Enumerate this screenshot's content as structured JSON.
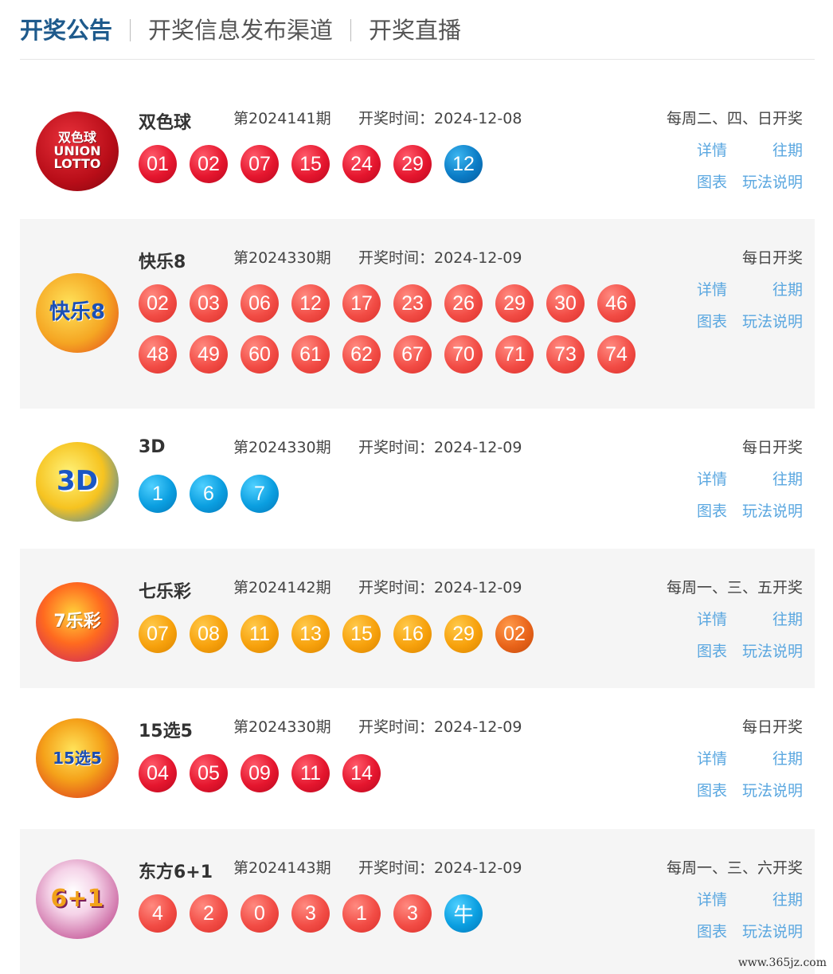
{
  "tabs": [
    "开奖公告",
    "开奖信息发布渠道",
    "开奖直播"
  ],
  "colors": {
    "accent": "#1e5a8c",
    "link": "#5aa7e0",
    "shaded_row": "#f5f5f5"
  },
  "link_labels": {
    "detail": "详情",
    "history": "往期",
    "chart": "图表",
    "rules": "玩法说明"
  },
  "lotteries": [
    {
      "name": "双色球",
      "logo_text": "双色球 UNION LOTTO",
      "issue": "第2024141期",
      "draw_time": "开奖时间：2024-12-08",
      "schedule": "每周二、四、日开奖",
      "balls": [
        {
          "n": "01",
          "c": "red"
        },
        {
          "n": "02",
          "c": "red"
        },
        {
          "n": "07",
          "c": "red"
        },
        {
          "n": "15",
          "c": "red"
        },
        {
          "n": "24",
          "c": "red"
        },
        {
          "n": "29",
          "c": "red"
        },
        {
          "n": "12",
          "c": "deepblue"
        }
      ]
    },
    {
      "name": "快乐8",
      "logo_text": "快乐8",
      "issue": "第2024330期",
      "draw_time": "开奖时间：2024-12-09",
      "schedule": "每日开奖",
      "balls": [
        {
          "n": "02",
          "c": "salmon"
        },
        {
          "n": "03",
          "c": "salmon"
        },
        {
          "n": "06",
          "c": "salmon"
        },
        {
          "n": "12",
          "c": "salmon"
        },
        {
          "n": "17",
          "c": "salmon"
        },
        {
          "n": "23",
          "c": "salmon"
        },
        {
          "n": "26",
          "c": "salmon"
        },
        {
          "n": "29",
          "c": "salmon"
        },
        {
          "n": "30",
          "c": "salmon"
        },
        {
          "n": "46",
          "c": "salmon"
        },
        {
          "n": "48",
          "c": "salmon"
        },
        {
          "n": "49",
          "c": "salmon"
        },
        {
          "n": "60",
          "c": "salmon"
        },
        {
          "n": "61",
          "c": "salmon"
        },
        {
          "n": "62",
          "c": "salmon"
        },
        {
          "n": "67",
          "c": "salmon"
        },
        {
          "n": "70",
          "c": "salmon"
        },
        {
          "n": "71",
          "c": "salmon"
        },
        {
          "n": "73",
          "c": "salmon"
        },
        {
          "n": "74",
          "c": "salmon"
        }
      ]
    },
    {
      "name": "3D",
      "logo_text": "3D",
      "issue": "第2024330期",
      "draw_time": "开奖时间：2024-12-09",
      "schedule": "每日开奖",
      "balls": [
        {
          "n": "1",
          "c": "blue"
        },
        {
          "n": "6",
          "c": "blue"
        },
        {
          "n": "7",
          "c": "blue"
        }
      ]
    },
    {
      "name": "七乐彩",
      "logo_text": "7乐彩",
      "issue": "第2024142期",
      "draw_time": "开奖时间：2024-12-09",
      "schedule": "每周一、三、五开奖",
      "balls": [
        {
          "n": "07",
          "c": "orange"
        },
        {
          "n": "08",
          "c": "orange"
        },
        {
          "n": "11",
          "c": "orange"
        },
        {
          "n": "13",
          "c": "orange"
        },
        {
          "n": "15",
          "c": "orange"
        },
        {
          "n": "16",
          "c": "orange"
        },
        {
          "n": "29",
          "c": "orange"
        },
        {
          "n": "02",
          "c": "darkorange"
        }
      ]
    },
    {
      "name": "15选5",
      "logo_text": "15选5",
      "issue": "第2024330期",
      "draw_time": "开奖时间：2024-12-09",
      "schedule": "每日开奖",
      "balls": [
        {
          "n": "04",
          "c": "red"
        },
        {
          "n": "05",
          "c": "red"
        },
        {
          "n": "09",
          "c": "red"
        },
        {
          "n": "11",
          "c": "red"
        },
        {
          "n": "14",
          "c": "red"
        }
      ]
    },
    {
      "name": "东方6+1",
      "logo_text": "6+1",
      "issue": "第2024143期",
      "draw_time": "开奖时间：2024-12-09",
      "schedule": "每周一、三、六开奖",
      "balls": [
        {
          "n": "4",
          "c": "salmon"
        },
        {
          "n": "2",
          "c": "salmon"
        },
        {
          "n": "0",
          "c": "salmon"
        },
        {
          "n": "3",
          "c": "salmon"
        },
        {
          "n": "1",
          "c": "salmon"
        },
        {
          "n": "3",
          "c": "salmon"
        },
        {
          "n": "牛",
          "c": "blue"
        }
      ]
    }
  ],
  "watermark": "www.365jz.com"
}
